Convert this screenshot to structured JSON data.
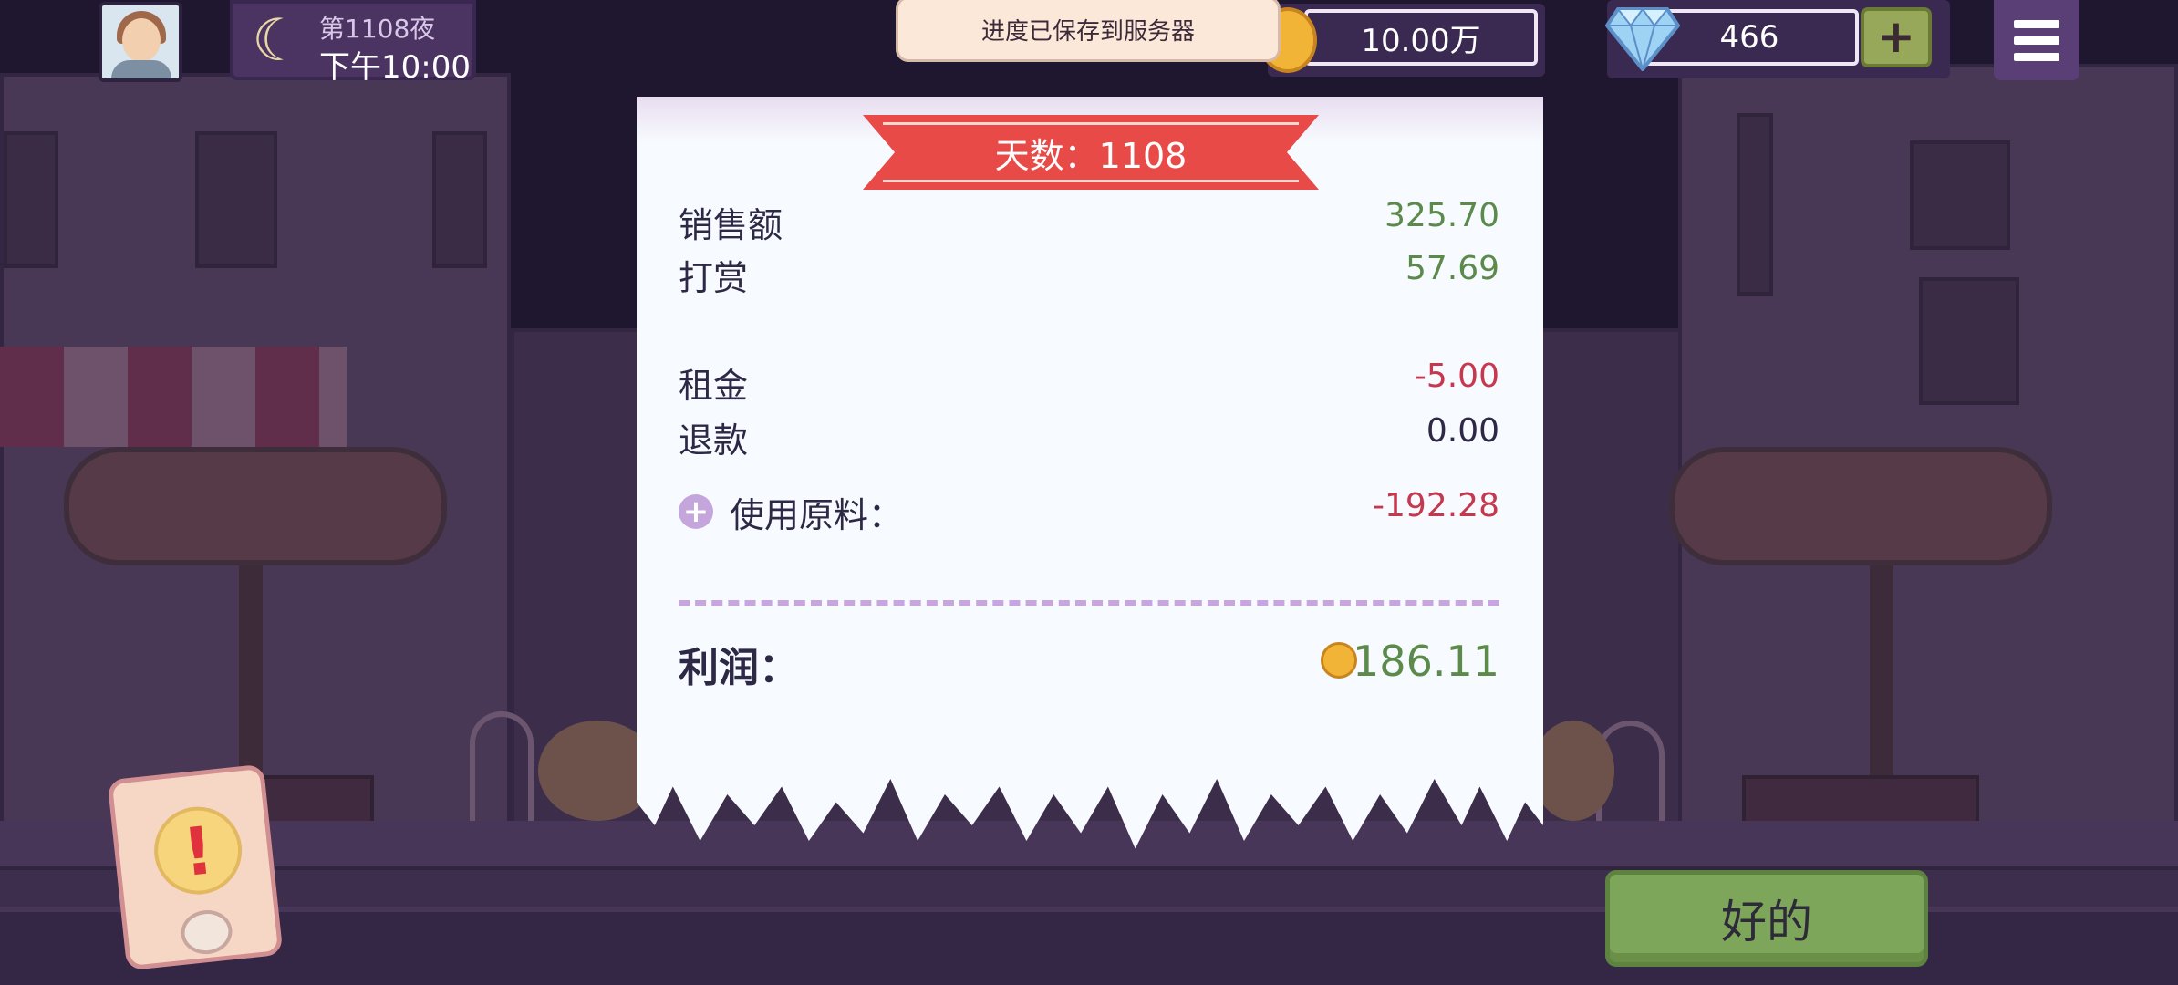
{
  "hud": {
    "day_label": "第1108夜",
    "time_label": "下午10:00",
    "toast": "进度已保存到服务器",
    "coins": "10.00万",
    "gems": "466",
    "plus": "+"
  },
  "receipt": {
    "title": "天数：1108",
    "rows": [
      {
        "label": "销售额",
        "value": "325.70"
      },
      {
        "label": "打赏",
        "value": "57.69"
      },
      {
        "label": "租金",
        "value": "-5.00"
      },
      {
        "label": "退款",
        "value": "0.00"
      }
    ],
    "materials_label": "使用原料：",
    "materials_value": "-192.28",
    "profit_label": "利润：",
    "profit_value": "186.11"
  },
  "buttons": {
    "ok": "好的",
    "alert": "!"
  },
  "icons": {
    "moon": "crescent-moon",
    "coin": "gold-coin",
    "gem": "diamond",
    "menu": "hamburger-menu",
    "add_materials": "plus-circle"
  },
  "colors": {
    "positive": "#5b8a4b",
    "negative": "#c6384d",
    "ribbon": "#e84a48",
    "ok_button": "#7ea65a"
  }
}
